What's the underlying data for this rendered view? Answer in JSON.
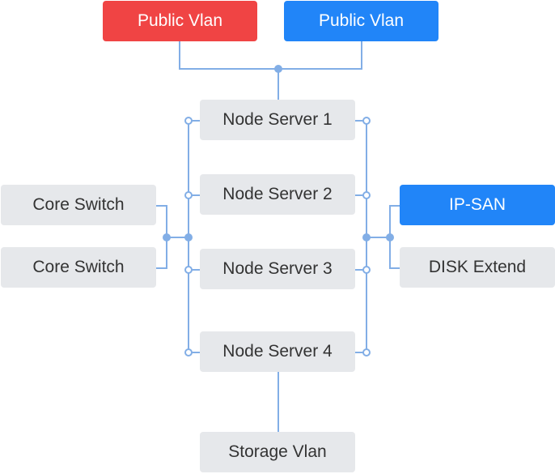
{
  "colors": {
    "line": "#82aee6",
    "red": "#f04444",
    "blue": "#2185f8",
    "box": "#e6e8eb",
    "text": "#333333"
  },
  "top": [
    {
      "label": "Public Vlan",
      "color": "red"
    },
    {
      "label": "Public Vlan",
      "color": "blue"
    }
  ],
  "nodes": [
    {
      "label": "Node Server 1"
    },
    {
      "label": "Node Server 2"
    },
    {
      "label": "Node Server 3"
    },
    {
      "label": "Node Server 4"
    }
  ],
  "left": [
    {
      "label": "Core Switch"
    },
    {
      "label": "Core Switch"
    }
  ],
  "right": [
    {
      "label": "IP-SAN"
    },
    {
      "label": "DISK Extend"
    }
  ],
  "bottom": {
    "label": "Storage Vlan"
  }
}
